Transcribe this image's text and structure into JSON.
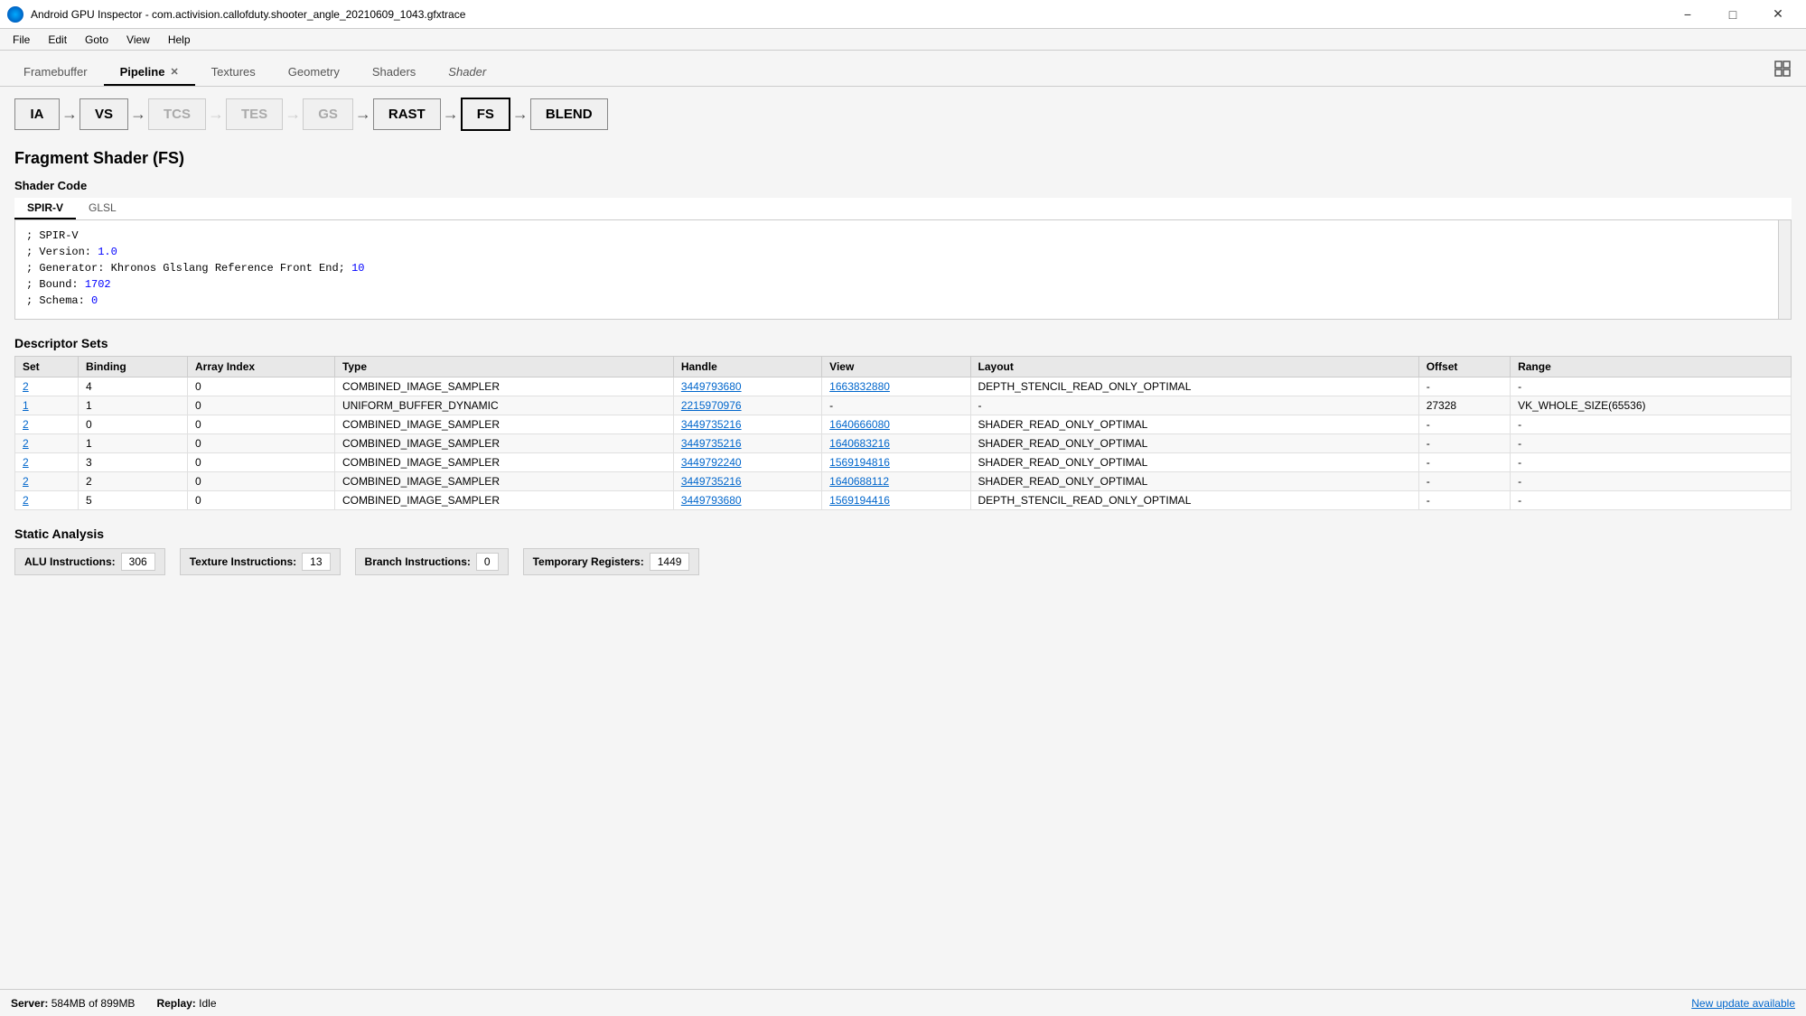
{
  "window": {
    "title": "Android GPU Inspector - com.activision.callofduty.shooter_angle_20210609_1043.gfxtrace",
    "minimize": "−",
    "maximize": "□",
    "close": "✕"
  },
  "menu": {
    "items": [
      "File",
      "Edit",
      "Goto",
      "View",
      "Help"
    ]
  },
  "tabs": [
    {
      "id": "framebuffer",
      "label": "Framebuffer",
      "active": false
    },
    {
      "id": "pipeline",
      "label": "Pipeline",
      "active": true
    },
    {
      "id": "textures",
      "label": "Textures",
      "active": false
    },
    {
      "id": "geometry",
      "label": "Geometry",
      "active": false
    },
    {
      "id": "shaders",
      "label": "Shaders",
      "active": false
    },
    {
      "id": "shader",
      "label": "Shader",
      "active": false,
      "italic": true
    }
  ],
  "pipeline": {
    "stages": [
      {
        "id": "ia",
        "label": "IA",
        "active": false,
        "dimmed": false
      },
      {
        "id": "vs",
        "label": "VS",
        "active": false,
        "dimmed": false
      },
      {
        "id": "tcs",
        "label": "TCS",
        "active": false,
        "dimmed": true
      },
      {
        "id": "tes",
        "label": "TES",
        "active": false,
        "dimmed": true
      },
      {
        "id": "gs",
        "label": "GS",
        "active": false,
        "dimmed": true
      },
      {
        "id": "rast",
        "label": "RAST",
        "active": false,
        "dimmed": false
      },
      {
        "id": "fs",
        "label": "FS",
        "active": true,
        "dimmed": false
      },
      {
        "id": "blend",
        "label": "BLEND",
        "active": false,
        "dimmed": false
      }
    ]
  },
  "fragment_shader": {
    "title": "Fragment Shader (FS)",
    "shader_code_label": "Shader Code",
    "code_tabs": [
      "SPIR-V",
      "GLSL"
    ],
    "active_code_tab": "SPIR-V",
    "code_lines": [
      "; SPIR-V",
      "; Version: 1.0",
      "; Generator: Khronos Glslang Reference Front End; 10",
      "; Bound: 1702",
      "; Schema: 0"
    ],
    "code_highlights": {
      "version": "1.0",
      "generator_num": "10",
      "bound": "1702",
      "schema": "0"
    }
  },
  "descriptor_sets": {
    "title": "Descriptor Sets",
    "columns": [
      "Set",
      "Binding",
      "Array Index",
      "Type",
      "Handle",
      "View",
      "Layout",
      "Offset",
      "Range"
    ],
    "rows": [
      {
        "set": "2",
        "binding": "4",
        "array_index": "0",
        "type": "COMBINED_IMAGE_SAMPLER",
        "handle": "3449793680",
        "view": "1663832880",
        "layout": "DEPTH_STENCIL_READ_ONLY_OPTIMAL",
        "offset": "-",
        "range": "-"
      },
      {
        "set": "1",
        "binding": "1",
        "array_index": "0",
        "type": "UNIFORM_BUFFER_DYNAMIC",
        "handle": "2215970976",
        "view": "-",
        "layout": "-",
        "offset": "27328",
        "range": "VK_WHOLE_SIZE(65536)"
      },
      {
        "set": "2",
        "binding": "0",
        "array_index": "0",
        "type": "COMBINED_IMAGE_SAMPLER",
        "handle": "3449735216",
        "view": "1640666080",
        "layout": "SHADER_READ_ONLY_OPTIMAL",
        "offset": "-",
        "range": "-"
      },
      {
        "set": "2",
        "binding": "1",
        "array_index": "0",
        "type": "COMBINED_IMAGE_SAMPLER",
        "handle": "3449735216",
        "view": "1640683216",
        "layout": "SHADER_READ_ONLY_OPTIMAL",
        "offset": "-",
        "range": "-"
      },
      {
        "set": "2",
        "binding": "3",
        "array_index": "0",
        "type": "COMBINED_IMAGE_SAMPLER",
        "handle": "3449792240",
        "view": "1569194816",
        "layout": "SHADER_READ_ONLY_OPTIMAL",
        "offset": "-",
        "range": "-"
      },
      {
        "set": "2",
        "binding": "2",
        "array_index": "0",
        "type": "COMBINED_IMAGE_SAMPLER",
        "handle": "3449735216",
        "view": "1640688112",
        "layout": "SHADER_READ_ONLY_OPTIMAL",
        "offset": "-",
        "range": "-"
      },
      {
        "set": "2",
        "binding": "5",
        "array_index": "0",
        "type": "COMBINED_IMAGE_SAMPLER",
        "handle": "3449793680",
        "view": "1569194416",
        "layout": "DEPTH_STENCIL_READ_ONLY_OPTIMAL",
        "offset": "-",
        "range": "-"
      }
    ]
  },
  "static_analysis": {
    "title": "Static Analysis",
    "stats": [
      {
        "label": "ALU Instructions:",
        "value": "306"
      },
      {
        "label": "Texture Instructions:",
        "value": "13"
      },
      {
        "label": "Branch Instructions:",
        "value": "0"
      },
      {
        "label": "Temporary Registers:",
        "value": "1449"
      }
    ]
  },
  "status_bar": {
    "server": "Server:",
    "server_value": "584MB of 899MB",
    "replay": "Replay:",
    "replay_value": "Idle",
    "update_text": "New update available"
  }
}
